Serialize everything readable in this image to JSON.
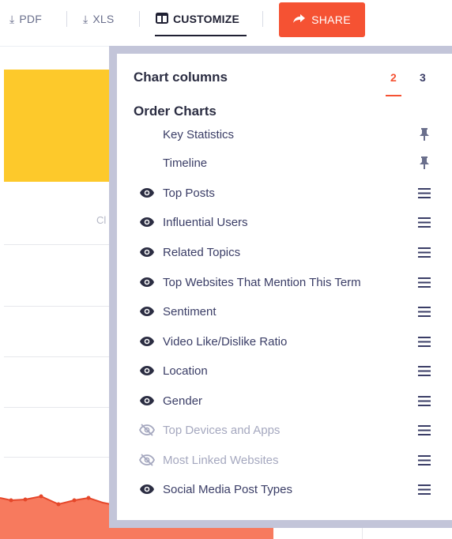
{
  "toolbar": {
    "pdf_label": "PDF",
    "xls_label": "XLS",
    "customize_label": "CUSTOMIZE",
    "share_label": "SHARE"
  },
  "background": {
    "partial_label": "Cl"
  },
  "panel": {
    "chart_columns_label": "Chart columns",
    "column_options": [
      "2",
      "3"
    ],
    "selected_columns": "2",
    "order_charts_label": "Order Charts",
    "items": [
      {
        "label": "Key Statistics",
        "state": "pinned"
      },
      {
        "label": "Timeline",
        "state": "pinned"
      },
      {
        "label": "Top Posts",
        "state": "visible"
      },
      {
        "label": "Influential Users",
        "state": "visible"
      },
      {
        "label": "Related Topics",
        "state": "visible"
      },
      {
        "label": "Top Websites That Mention This Term",
        "state": "visible"
      },
      {
        "label": "Sentiment",
        "state": "visible"
      },
      {
        "label": "Video Like/Dislike Ratio",
        "state": "visible"
      },
      {
        "label": "Location",
        "state": "visible"
      },
      {
        "label": "Gender",
        "state": "visible"
      },
      {
        "label": "Top Devices and Apps",
        "state": "hidden"
      },
      {
        "label": "Most Linked Websites",
        "state": "hidden"
      },
      {
        "label": "Social Media Post Types",
        "state": "visible"
      }
    ]
  },
  "colors": {
    "accent": "#f55233",
    "yellow": "#fdc92b",
    "panel_border": "#c3c5d9",
    "text_primary": "#3a3d66",
    "text_muted": "#a5a8bf"
  }
}
